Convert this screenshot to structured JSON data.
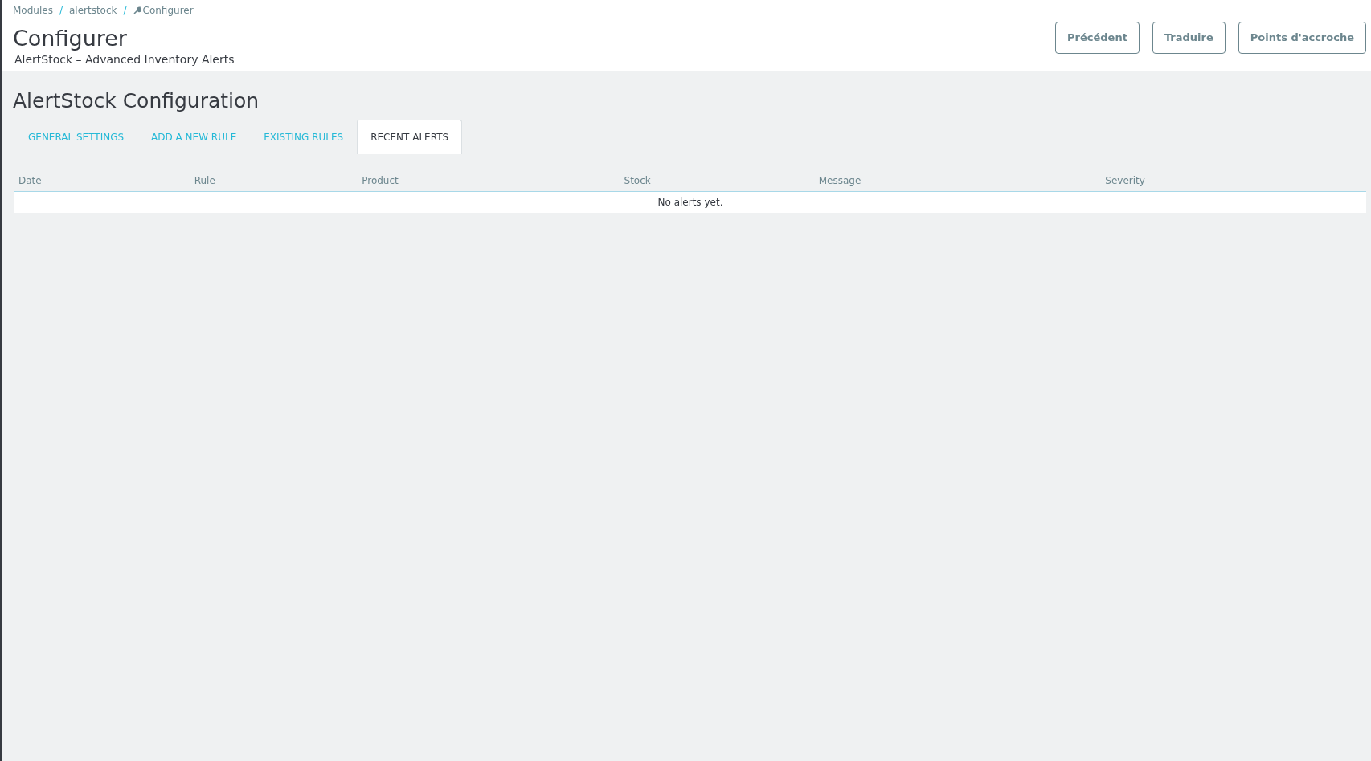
{
  "breadcrumb": [
    {
      "label": "Modules",
      "icon": false
    },
    {
      "separator": "/"
    },
    {
      "label": "alertstock",
      "icon": false
    },
    {
      "separator": "/"
    },
    {
      "label": "Configurer",
      "icon": true
    }
  ],
  "page_title": "Configurer",
  "page_subtitle": "AlertStock – Advanced Inventory Alerts",
  "toolbar_buttons": [
    "Précédent",
    "Traduire",
    "Points d'accroche"
  ],
  "section_title": "AlertStock Configuration",
  "tabs": [
    {
      "label": "GENERAL SETTINGS",
      "selected": false
    },
    {
      "label": "ADD A NEW RULE",
      "selected": false
    },
    {
      "label": "EXISTING RULES",
      "selected": false
    },
    {
      "label": "RECENT ALERTS",
      "selected": true
    }
  ],
  "table": {
    "columns": [
      "Date",
      "Rule",
      "Product",
      "Stock",
      "Message",
      "Severity"
    ],
    "empty_message": "No alerts yet."
  }
}
